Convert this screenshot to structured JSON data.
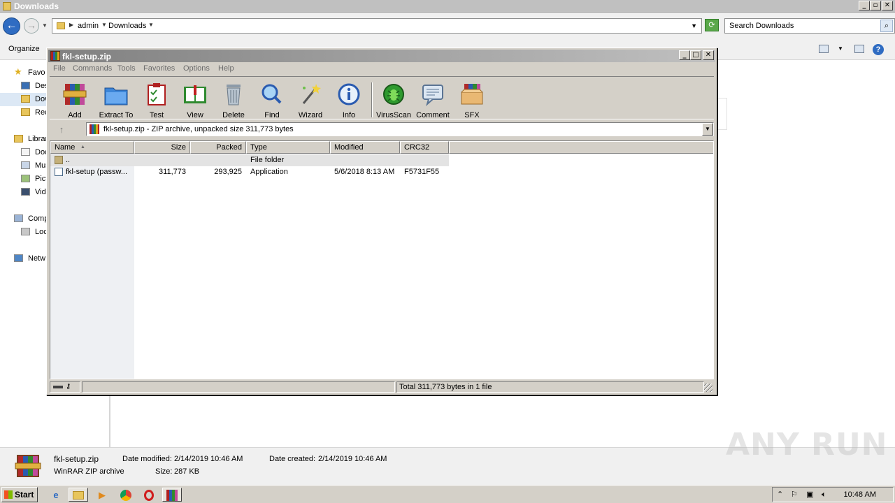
{
  "explorer": {
    "title": "Downloads",
    "breadcrumb": [
      "admin",
      "Downloads"
    ],
    "search_placeholder": "Search Downloads",
    "organize_label": "Organize",
    "nav_items": [
      "Favo",
      "Des",
      "Dov",
      "Rec",
      "Librar",
      "Doc",
      "Mus",
      "Pict",
      "Vide",
      "Comp",
      "Loc",
      "Netw"
    ]
  },
  "winrar": {
    "title": "fkl-setup.zip",
    "menu": [
      "File",
      "Commands",
      "Tools",
      "Favorites",
      "Options",
      "Help"
    ],
    "toolbar": [
      {
        "label": "Add",
        "icon": "add-icon"
      },
      {
        "label": "Extract To",
        "icon": "extract-folder-icon"
      },
      {
        "label": "Test",
        "icon": "test-clipboard-icon"
      },
      {
        "label": "View",
        "icon": "view-book-icon"
      },
      {
        "label": "Delete",
        "icon": "trash-icon"
      },
      {
        "label": "Find",
        "icon": "magnifier-icon"
      },
      {
        "label": "Wizard",
        "icon": "wand-icon"
      },
      {
        "label": "Info",
        "icon": "info-icon"
      },
      {
        "label": "VirusScan",
        "icon": "bug-icon"
      },
      {
        "label": "Comment",
        "icon": "comment-icon"
      },
      {
        "label": "SFX",
        "icon": "sfx-box-icon"
      }
    ],
    "path_text": "fkl-setup.zip - ZIP archive, unpacked size 311,773 bytes",
    "columns": [
      "Name",
      "Size",
      "Packed",
      "Type",
      "Modified",
      "CRC32"
    ],
    "rows": [
      {
        "name": "..",
        "size": "",
        "packed": "",
        "type": "File folder",
        "modified": "",
        "crc": ""
      },
      {
        "name": "fkl-setup (passw...",
        "size": "311,773",
        "packed": "293,925",
        "type": "Application",
        "modified": "5/6/2018 8:13 AM",
        "crc": "F5731F55"
      }
    ],
    "status_total": "Total 311,773 bytes in 1 file"
  },
  "details": {
    "filename": "fkl-setup.zip",
    "filetype": "WinRAR ZIP archive",
    "modified_label": "Date modified:",
    "modified_value": "2/14/2019 10:46 AM",
    "created_label": "Date created:",
    "created_value": "2/14/2019 10:46 AM",
    "size_label": "Size:",
    "size_value": "287 KB"
  },
  "watermark": "ANY RUN",
  "taskbar": {
    "start_label": "Start",
    "apps": [
      "ie-icon",
      "explorer-icon",
      "media-player-icon",
      "chrome-icon",
      "opera-icon",
      "winrar-icon"
    ],
    "clock": "10:48 AM"
  },
  "colors": {
    "titlebar_gray": "#c0c0c0",
    "classic_face": "#d4d0c8",
    "accent_blue": "#2f6cc2"
  }
}
